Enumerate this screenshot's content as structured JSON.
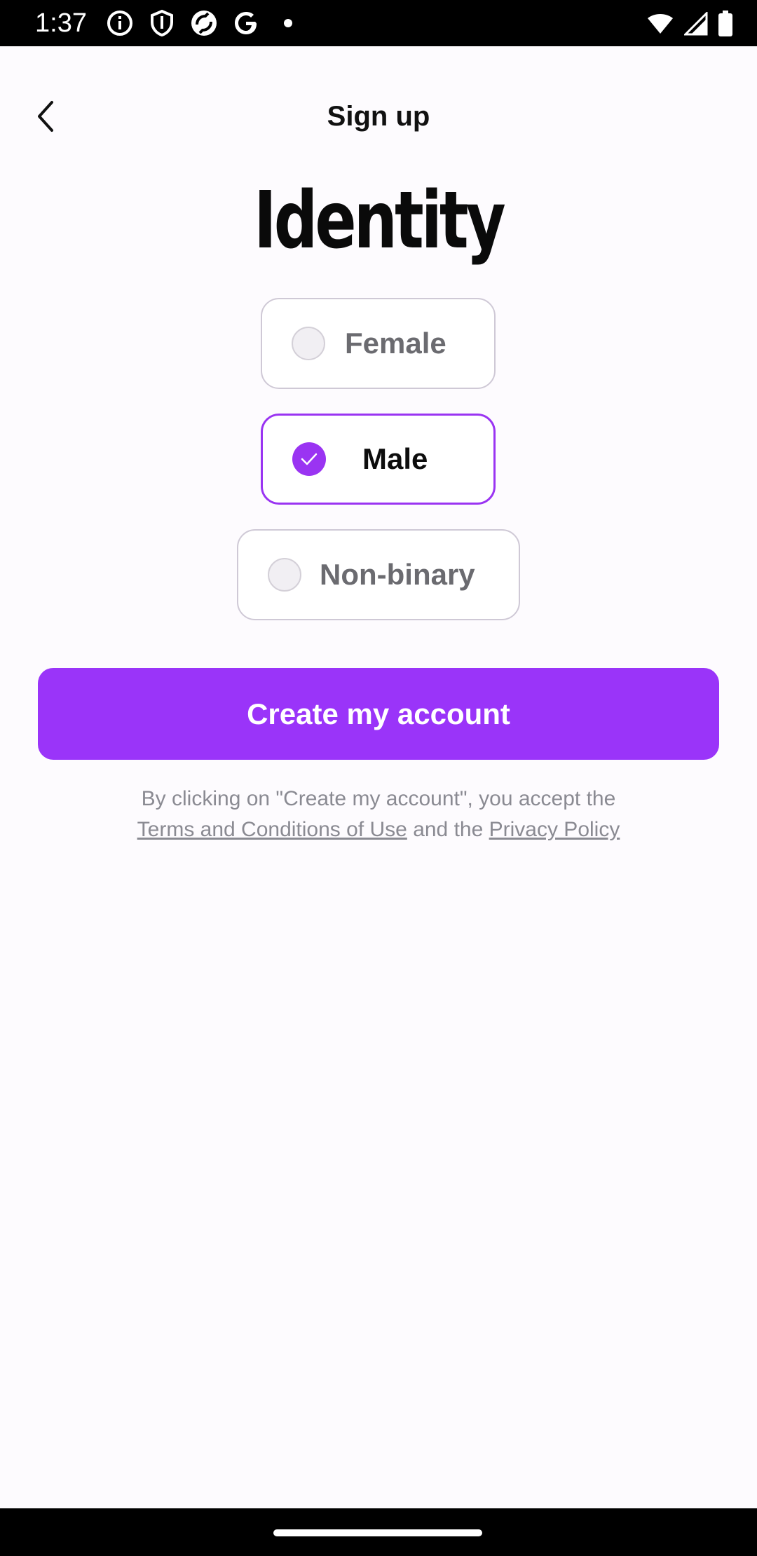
{
  "status_bar": {
    "time": "1:37",
    "icons": [
      "info-icon",
      "shield-icon",
      "sync-icon",
      "google-icon",
      "dot-icon"
    ],
    "right_icons": [
      "wifi-icon",
      "signal-icon",
      "battery-icon"
    ]
  },
  "header": {
    "title": "Sign up",
    "back_icon": "chevron-left-icon"
  },
  "page": {
    "title": "Identity"
  },
  "options": [
    {
      "label": "Female",
      "selected": false
    },
    {
      "label": "Male",
      "selected": true
    },
    {
      "label": "Non-binary",
      "selected": false
    }
  ],
  "cta": {
    "label": "Create my account"
  },
  "legal": {
    "prefix": "By clicking on \"Create my account\", you accept the",
    "terms_link": "Terms and Conditions of Use",
    "middle": "and the",
    "privacy_link": "Privacy Policy"
  },
  "colors": {
    "accent": "#9a34f9",
    "background": "#fdfbfe",
    "text": "#0d0d0d",
    "muted_text": "#8a8a92"
  }
}
